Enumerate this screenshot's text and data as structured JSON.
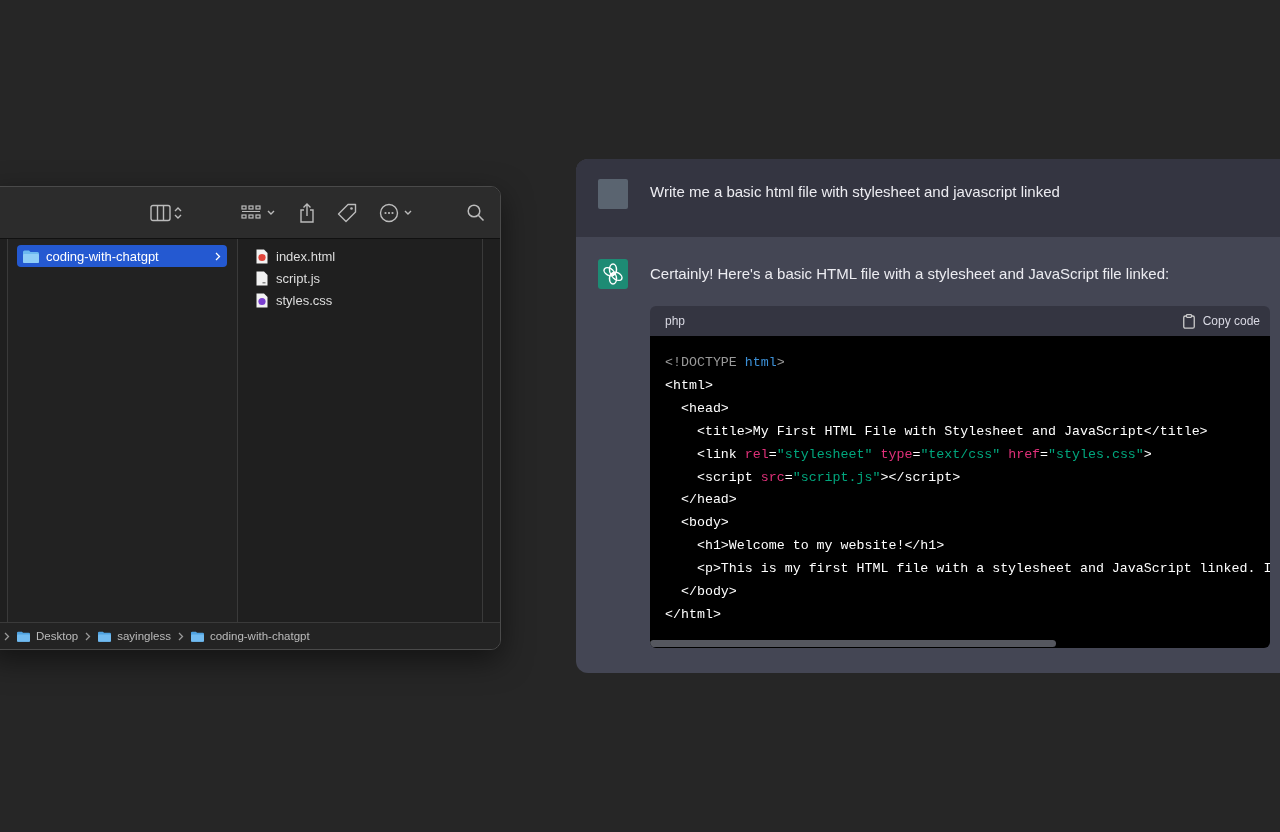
{
  "finder": {
    "column_1": [
      {
        "label": "coding-with-chatgpt",
        "selected": true
      }
    ],
    "column_2": [
      {
        "name": "index.html",
        "kind": "html"
      },
      {
        "name": "script.js",
        "kind": "js"
      },
      {
        "name": "styles.css",
        "kind": "css"
      }
    ],
    "path_bar": [
      "Desktop",
      "sayingless",
      "coding-with-chatgpt"
    ]
  },
  "chat": {
    "user_message": "Write me a basic html file with stylesheet and javascript linked",
    "assistant_message": "Certainly! Here's a basic HTML file with a stylesheet and JavaScript file linked:",
    "code_block": {
      "language": "php",
      "copy_label": "Copy code",
      "lines": [
        [
          {
            "kind": "meta",
            "text": "<!DOCTYPE "
          },
          {
            "kind": "keyword",
            "text": "html"
          },
          {
            "kind": "meta",
            "text": ">"
          }
        ],
        [
          {
            "kind": "plain",
            "text": "<html>"
          }
        ],
        [
          {
            "kind": "plain",
            "text": "  <head>"
          }
        ],
        [
          {
            "kind": "plain",
            "text": "    <title>My First HTML File with Stylesheet and JavaScript</title>"
          }
        ],
        [
          {
            "kind": "plain",
            "text": "    <link "
          },
          {
            "kind": "attr",
            "text": "rel"
          },
          {
            "kind": "plain",
            "text": "="
          },
          {
            "kind": "string",
            "text": "\"stylesheet\""
          },
          {
            "kind": "attr",
            "text": " type"
          },
          {
            "kind": "plain",
            "text": "="
          },
          {
            "kind": "string",
            "text": "\"text/css\""
          },
          {
            "kind": "attr",
            "text": " href"
          },
          {
            "kind": "plain",
            "text": "="
          },
          {
            "kind": "string",
            "text": "\"styles.css\""
          },
          {
            "kind": "plain",
            "text": ">"
          }
        ],
        [
          {
            "kind": "plain",
            "text": "    <script "
          },
          {
            "kind": "attr",
            "text": "src"
          },
          {
            "kind": "plain",
            "text": "="
          },
          {
            "kind": "string",
            "text": "\"script.js\""
          },
          {
            "kind": "plain",
            "text": "></script>"
          }
        ],
        [
          {
            "kind": "plain",
            "text": "  </head>"
          }
        ],
        [
          {
            "kind": "plain",
            "text": "  <body>"
          }
        ],
        [
          {
            "kind": "plain",
            "text": "    <h1>Welcome to my website!</h1>"
          }
        ],
        [
          {
            "kind": "plain",
            "text": "    <p>This is my first HTML file with a stylesheet and JavaScript linked. I"
          }
        ],
        [
          {
            "kind": "plain",
            "text": "  </body>"
          }
        ],
        [
          {
            "kind": "plain",
            "text": "</html>"
          }
        ]
      ]
    }
  }
}
